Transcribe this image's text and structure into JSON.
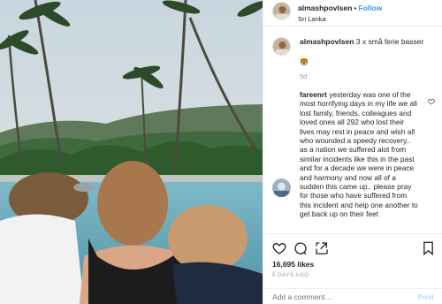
{
  "post": {
    "image_description_icon": "photo-of-beach-with-palm-trees"
  },
  "header": {
    "username": "almashpovlsen",
    "separator": "•",
    "follow_label": "Follow",
    "location": "Sri Lanka"
  },
  "caption": {
    "username": "almashpovlsen",
    "text": "3 x små ferie basser",
    "emoji": "🐯",
    "time": "5d"
  },
  "comment": {
    "username": "fareenrt",
    "text": "yesterday was one of the most horrifying days in my life we all lost family, friends, colleagues and loved ones all 292 who lost their lives may rest in peace and wish all who wounded a speedy recovery.. as a nation we suffered alot from similar incidents like this in the past and for a decade we were in peace and harmony and now all of a sudden this came up.. please pray for those who have suffered from this incident and help one another to get back up on their feet"
  },
  "actions": {
    "likes": "16,695 likes",
    "time_ago": "5 DAYS AGO",
    "add_comment_placeholder": "Add a comment…",
    "post_label": "Post"
  },
  "icons": {
    "like": "heart-icon",
    "comment": "comment-icon",
    "share": "share-icon",
    "save": "bookmark-icon",
    "comment_like": "heart-icon"
  },
  "colors": {
    "follow": "#3897f0",
    "post_disabled": "#b3dbff",
    "muted": "#999999",
    "text": "#262626"
  }
}
